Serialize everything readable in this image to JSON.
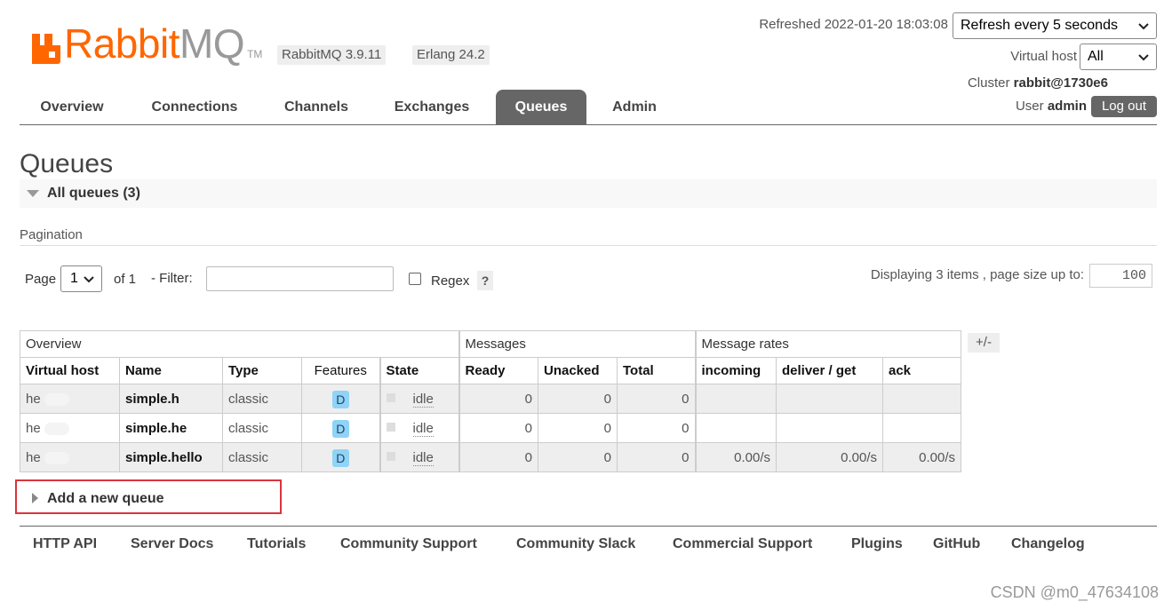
{
  "brand": {
    "name_colored": "Rabbit",
    "name_gray": "MQ",
    "trademark": "TM",
    "brand_color": "#ff6600"
  },
  "versions": {
    "rabbitmq": "RabbitMQ 3.9.11",
    "erlang": "Erlang 24.2"
  },
  "header": {
    "refreshed": "Refreshed 2022-01-20 18:03:08",
    "refresh_select": "Refresh every 5 seconds",
    "virtual_host_label": "Virtual host",
    "virtual_host_value": "All",
    "cluster_label": "Cluster",
    "cluster_value": "rabbit@1730e6",
    "user_label": "User",
    "user_value": "admin",
    "logout": "Log out"
  },
  "nav": {
    "tabs": [
      "Overview",
      "Connections",
      "Channels",
      "Exchanges",
      "Queues",
      "Admin"
    ],
    "active": "Queues"
  },
  "page": {
    "title": "Queues",
    "section_label": "All queues (3)",
    "pagination_label": "Pagination",
    "page_label": "Page",
    "page_value": "1",
    "of_label": "of 1",
    "filter_label": "- Filter:",
    "filter_value": "",
    "regex_label": "Regex",
    "help": "?",
    "displaying": "Displaying 3 items , page size up to:",
    "page_size": "100"
  },
  "table": {
    "groups": [
      "Overview",
      "Messages",
      "Message rates"
    ],
    "columns": [
      "Virtual host",
      "Name",
      "Type",
      "Features",
      "State",
      "Ready",
      "Unacked",
      "Total",
      "incoming",
      "deliver / get",
      "ack"
    ],
    "plus_minus": "+/-",
    "rows": [
      {
        "vhost": "he",
        "name": "simple.h",
        "type": "classic",
        "feature": "D",
        "state": "idle",
        "ready": "0",
        "unacked": "0",
        "total": "0",
        "incoming": "",
        "deliver_get": "",
        "ack": ""
      },
      {
        "vhost": "he",
        "name": "simple.he",
        "type": "classic",
        "feature": "D",
        "state": "idle",
        "ready": "0",
        "unacked": "0",
        "total": "0",
        "incoming": "",
        "deliver_get": "",
        "ack": ""
      },
      {
        "vhost": "he",
        "name": "simple.hello",
        "type": "classic",
        "feature": "D",
        "state": "idle",
        "ready": "0",
        "unacked": "0",
        "total": "0",
        "incoming": "0.00/s",
        "deliver_get": "0.00/s",
        "ack": "0.00/s"
      }
    ]
  },
  "add_queue": {
    "label": "Add a new queue",
    "highlight_color": "#d9353b"
  },
  "footer": {
    "links": [
      "HTTP API",
      "Server Docs",
      "Tutorials",
      "Community Support",
      "Community Slack",
      "Commercial Support",
      "Plugins",
      "GitHub",
      "Changelog"
    ]
  },
  "watermark": "CSDN @m0_47634108"
}
